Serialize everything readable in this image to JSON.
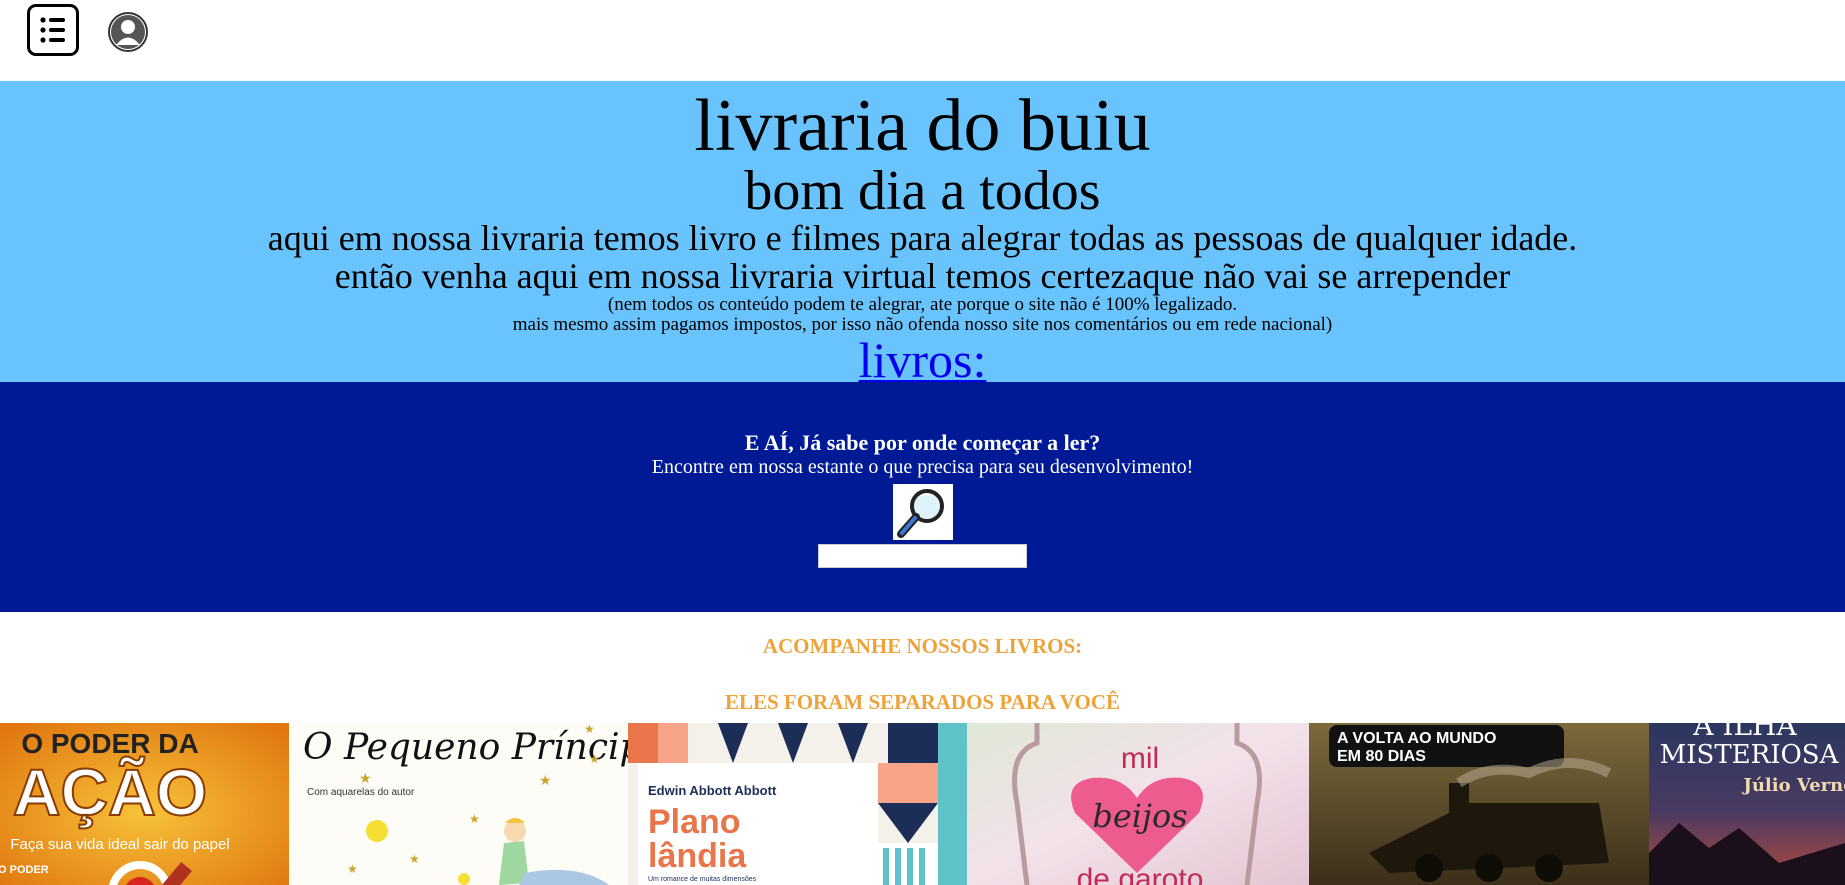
{
  "header": {
    "menu_icon": "list-icon",
    "profile_icon": "user-avatar-icon"
  },
  "hero": {
    "title": "livraria do buiu",
    "subtitle": "bom dia a todos",
    "line1": "aqui em nossa livraria temos livro e filmes para alegrar todas as pessoas de qualquer idade.",
    "line2": "então venha aqui em nossa livraria virtual temos certezaque não vai se arrepender",
    "note1": "(nem todos os conteúdo podem te alegrar, ate porque o site não é 100% legalizado.",
    "note2": "mais mesmo assim pagamos impostos, por isso não ofenda nosso site nos comentários ou em rede nacional)",
    "link": "livros:"
  },
  "search": {
    "question": "E AÍ, Já sabe por onde começar a ler?",
    "subtext": "Encontre em nossa estante o que precisa para seu desenvolvimento!",
    "icon": "magnifier-icon",
    "input_value": "",
    "input_placeholder": ""
  },
  "books": {
    "heading1": "ACOMPANHE NOSSOS LIVROS:",
    "heading2": "ELES FORAM SEPARADOS PARA VOCÊ",
    "covers": [
      {
        "line1": "O PODER DA",
        "line2": "AÇÃO",
        "line3": "Faça sua vida ideal sair do papel",
        "extra": "O PODER"
      },
      {
        "line1": "O Pequeno Príncipe",
        "line2": "Com aquarelas do autor"
      },
      {
        "line1": "Edwin Abbott Abbott",
        "line2": "Plano",
        "line3": "lândia",
        "line4": "Um romance de muitas dimensões"
      },
      {
        "line1": "mil",
        "line2": "beijos",
        "line3": "de garoto"
      },
      {
        "line1": "A VOLTA AO MUNDO",
        "line2": "EM 80 DIAS"
      },
      {
        "line1": "A ILHA",
        "line2": "MISTERIOSA",
        "line3": "Júlio Verne"
      }
    ]
  },
  "colors": {
    "hero_bg": "#69c4fd",
    "search_bg": "#001a96",
    "heading": "#eda33a",
    "link": "#0000ee"
  }
}
